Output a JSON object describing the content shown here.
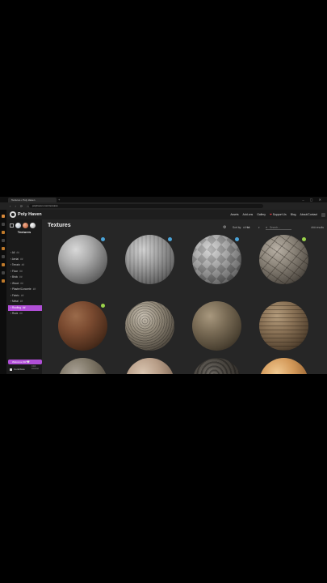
{
  "browser": {
    "tab_title": "Textures • Poly Haven",
    "new_tab": "+",
    "window_controls": "–  ▢  ✕",
    "nav_buttons": "‹ › ⟳ ⌂",
    "url": "polyhaven.com/textures"
  },
  "header": {
    "brand": "Poly Haven",
    "nav": {
      "assets": "Assets",
      "addons": "Add-ons",
      "gallery": "Gallery",
      "support_icon": "❤",
      "support": "Support Us",
      "blog": "Blog",
      "about": "About/Contact"
    }
  },
  "sidebar": {
    "title": "Textures",
    "categories": [
      {
        "label": "All",
        "count": "##"
      },
      {
        "label": "Aerial",
        "count": "##"
      },
      {
        "label": "Terrain",
        "count": "##"
      },
      {
        "label": "Floor",
        "count": "##"
      },
      {
        "label": "Brick",
        "count": "##"
      },
      {
        "label": "Wood",
        "count": "##"
      },
      {
        "label": "Plaster/Concrete",
        "count": "##"
      },
      {
        "label": "Fabric",
        "count": "##"
      },
      {
        "label": "Metal",
        "count": "##"
      },
      {
        "label": "Roofing",
        "count": "##"
      },
      {
        "label": "Rock",
        "count": "##"
      }
    ],
    "active_index": 9,
    "welcome": "Welcome ##/ 🤍",
    "contribute": "Contribute",
    "license": "CC0 License"
  },
  "main": {
    "title": "Textures",
    "sort_label": "Sort by:",
    "sort_value": "⏲ Hot",
    "sort_caret": "▾",
    "search_placeholder": "Search...",
    "results": "### results"
  },
  "colors": {
    "accent": "#b04fd6",
    "badge_blue": "#4aa3d8",
    "badge_green": "#9ad24a",
    "page_bg": "#262626"
  }
}
